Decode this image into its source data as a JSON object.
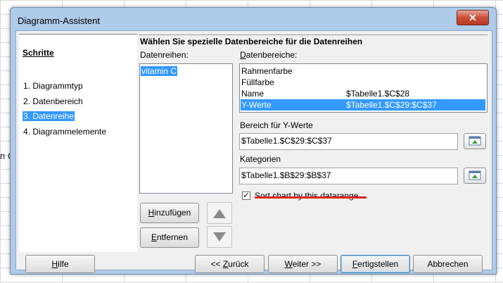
{
  "sheet": {
    "cell_fragment": "n C"
  },
  "window": {
    "title": "Diagramm-Assistent",
    "close_glyph": "✕"
  },
  "steps": {
    "title": "Schritte",
    "items": [
      {
        "label": "1. Diagrammtyp"
      },
      {
        "label": "2. Datenbereich"
      },
      {
        "label": "3. Datenreihe",
        "active": true
      },
      {
        "label": "4. Diagrammelemente"
      }
    ]
  },
  "page": {
    "heading": "Wählen Sie spezielle Datenbereiche für die Datenreihen",
    "series_label": "Datenreihen:",
    "series": [
      "vitamin C"
    ],
    "ranges_label": "Datenbereiche:",
    "ranges": [
      {
        "role": "Rahmenfarbe",
        "range": ""
      },
      {
        "role": "Füllfarbe",
        "range": ""
      },
      {
        "role": "Name",
        "range": "$Tabelle1.$C$28"
      },
      {
        "role": "Y-Werte",
        "range": "$Tabelle1.$C$29:$C$37",
        "selected": true
      }
    ],
    "y_range_label": "Bereich für Y-Werte",
    "y_range_value": "$Tabelle1.$C$29:$C$37",
    "categories_label": "Kategorien",
    "categories_value": "$Tabelle1.$B$29:$B$37",
    "sort_label": "Sort chart by this datarange",
    "sort_checked": true,
    "add_button": "Hinzufügen",
    "remove_button": "Entfernen"
  },
  "footer": {
    "help": "Hilfe",
    "back": "<< Zurück",
    "next": "Weiter >>",
    "finish": "Fertigstellen",
    "cancel": "Abbrechen"
  },
  "colors": {
    "selection": "#3399ff",
    "dialog_bg": "#f0f0f0",
    "frame": "#aecbe9",
    "close": "#c9503a",
    "spellcheck": "#e02020"
  }
}
